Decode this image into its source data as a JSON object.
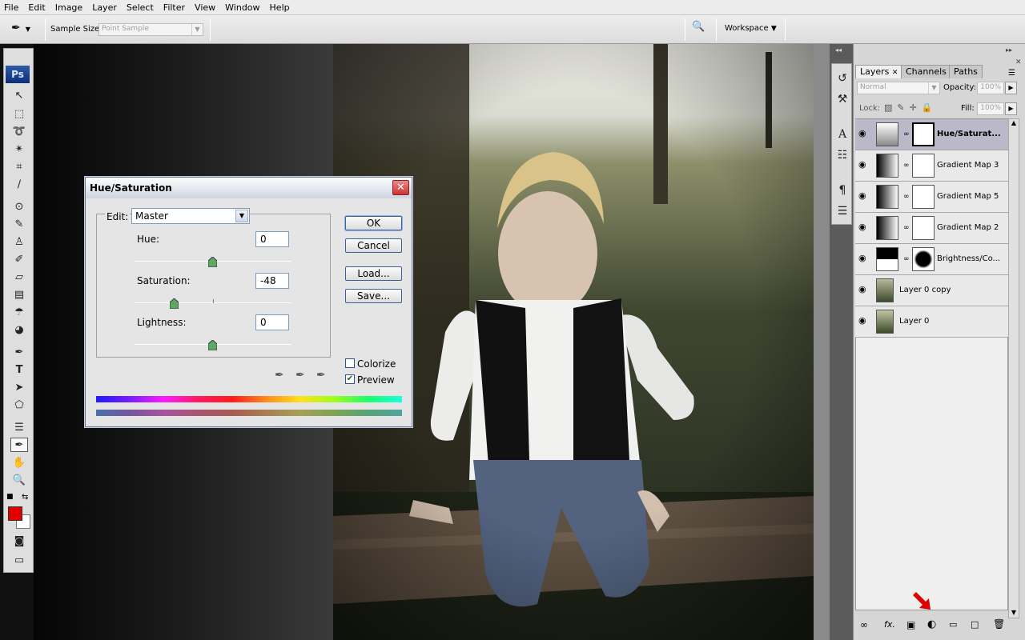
{
  "menu": [
    "File",
    "Edit",
    "Image",
    "Layer",
    "Select",
    "Filter",
    "View",
    "Window",
    "Help"
  ],
  "options_bar": {
    "sample_size_label": "Sample Size:",
    "sample_size_value": "Point Sample",
    "workspace_label": "Workspace"
  },
  "toolbox": {
    "logo": "Ps",
    "foreground_color": "#e00000",
    "background_color": "#ffffff"
  },
  "layers_panel": {
    "tabs": [
      "Layers",
      "Channels",
      "Paths"
    ],
    "blend_mode": "Normal",
    "opacity_label": "Opacity:",
    "opacity_value": "100%",
    "lock_label": "Lock:",
    "fill_label": "Fill:",
    "fill_value": "100%",
    "layers": [
      {
        "name": "Hue/Saturat...",
        "selected": true
      },
      {
        "name": "Gradient Map 3",
        "selected": false
      },
      {
        "name": "Gradient Map 5",
        "selected": false
      },
      {
        "name": "Gradient Map 2",
        "selected": false
      },
      {
        "name": "Brightness/Co...",
        "selected": false
      },
      {
        "name": "Layer 0 copy",
        "selected": false
      },
      {
        "name": "Layer 0",
        "selected": false
      }
    ]
  },
  "dialog": {
    "title": "Hue/Saturation",
    "edit_label": "Edit:",
    "edit_value": "Master",
    "hue_label": "Hue:",
    "hue_value": "0",
    "saturation_label": "Saturation:",
    "saturation_value": "-48",
    "lightness_label": "Lightness:",
    "lightness_value": "0",
    "buttons": {
      "ok": "OK",
      "cancel": "Cancel",
      "load": "Load...",
      "save": "Save..."
    },
    "colorize_label": "Colorize",
    "colorize_checked": false,
    "preview_label": "Preview",
    "preview_checked": true
  }
}
